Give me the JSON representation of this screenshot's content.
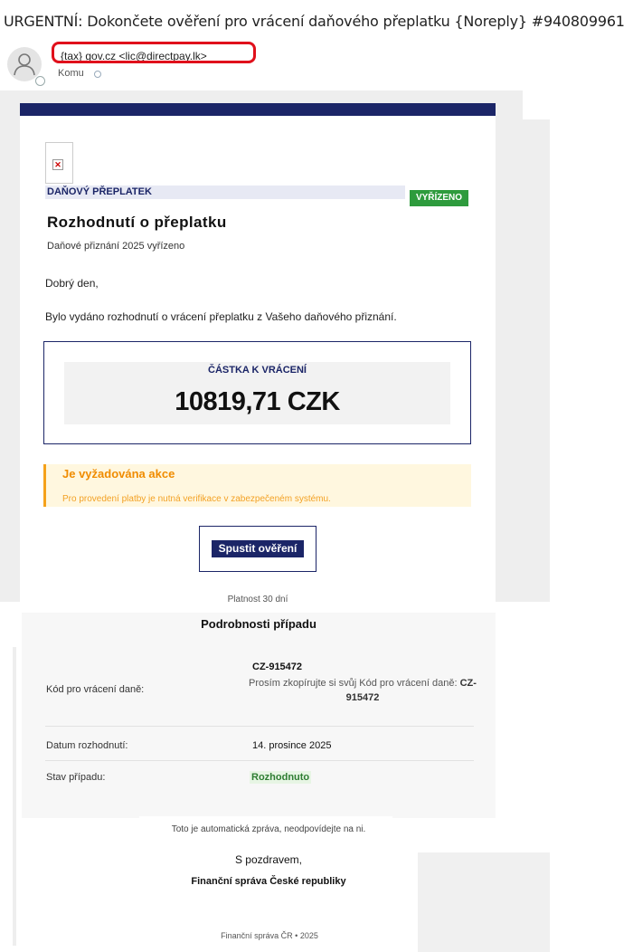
{
  "email": {
    "subject": "URGENTNÍ: Dokončete ověření pro vrácení daňového přeplatku {Noreply} #940809961",
    "sender": "{tax} gov.cz <lic@directpay.lk>",
    "to_label": "Komu"
  },
  "letter": {
    "tag": "DAŇOVÝ PŘEPLATEK",
    "status": "VYŘÍZENO",
    "title": "Rozhodnutí o přeplatku",
    "subtitle": "Daňové přiznání 2025 vyřízeno",
    "greeting": "Dobrý den,",
    "body": "Bylo vydáno rozhodnutí o vrácení přeplatku z Vašeho daňového přiznání.",
    "amount_label": "ČÁSTKA K VRÁCENÍ",
    "amount_value": "10819,71 CZK",
    "warning_title": "Je vyžadována akce",
    "warning_text": "Pro provedení platby je nutná verifikace v zabezpečeném systému.",
    "cta_label": "Spustit ověření",
    "validity": "Platnost 30 dní"
  },
  "details": {
    "heading": "Podrobnosti případu",
    "rows": [
      {
        "label": "Kód pro vrácení daně:",
        "value": "CZ-915472"
      },
      {
        "label": "Datum rozhodnutí:",
        "value": "14. prosince 2025"
      },
      {
        "label": "Stav případu:",
        "value": "Rozhodnuto"
      }
    ],
    "code_note_prefix": "Prosím zkopírujte si svůj Kód pro vrácení daně:",
    "code_note_code": "CZ-915472"
  },
  "footer": {
    "auto_msg": "Toto je automatická zpráva, neodpovídejte na ni.",
    "regards": "S pozdravem,",
    "signature": "Finanční správa České republiky",
    "copyright": "Finanční správa ČR • 2025"
  },
  "colors": {
    "navy": "#1b2567",
    "green": "#2e9b3d",
    "warning": "#f08c00",
    "highlight_red": "#e0101b"
  }
}
